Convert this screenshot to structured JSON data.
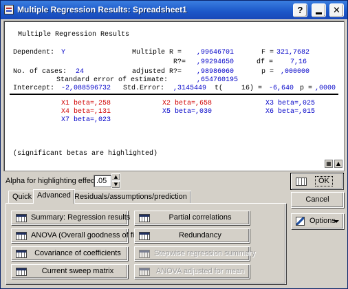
{
  "window": {
    "title": "Multiple Regression Results: Spreadsheet1"
  },
  "titlebar_buttons": {
    "help": "?",
    "close": "✕"
  },
  "output": {
    "heading": "Multiple Regression Results",
    "dependent_label": "Dependent:",
    "dependent_value": "Y",
    "multiple_r_label": "Multiple R =",
    "multiple_r_value": ",99646701",
    "f_label": "F =",
    "f_value": "321,7682",
    "r2_label": "R?=",
    "r2_value": ",99294650",
    "df_label": "df =",
    "df_value": "7,16",
    "cases_label": "No. of cases:",
    "cases_value": "24",
    "adj_r2_label": "adjusted R?=",
    "adj_r2_value": ",98986060",
    "p_label": "p =",
    "p_value": ",000000",
    "se_label": "Standard error of estimate:",
    "se_value": ",654760195",
    "intercept_label": "Intercept:",
    "intercept_value": "-2,088596732",
    "std_error_label": "Std.Error:",
    "std_error_value": ",3145449",
    "t_label": "t(",
    "t_df": "16) =",
    "t_value": "-6,640",
    "p2_label": "p =",
    "p2_value": ",0000",
    "betas": [
      "X1 beta=,258",
      "X2 beta=,658",
      "X3 beta=,025",
      "X4 beta=,131",
      "X5 beta=,030",
      "X6 beta=,015",
      "X7 beta=,023"
    ],
    "footnote": "(significant betas are highlighted)"
  },
  "alpha": {
    "label": "Alpha for highlighting effects:",
    "value": ".05"
  },
  "tabs": [
    "Quick",
    "Advanced",
    "Residuals/assumptions/prediction"
  ],
  "buttons": {
    "summary": "Summary:  Regression results",
    "partial": "Partial correlations",
    "anova": "ANOVA (Overall goodness of fit)",
    "redundancy": "Redundancy",
    "covariance": "Covariance of coefficients",
    "stepwise": "Stepwise regression summary",
    "sweep": "Current sweep matrix",
    "anova_adj": "ANOVA adjusted for mean",
    "ok": "OK",
    "cancel": "Cancel",
    "options": "Options"
  },
  "colors": {
    "blue": "#0000c8",
    "red": "#d00000",
    "titlebar": "#1c57c8"
  }
}
